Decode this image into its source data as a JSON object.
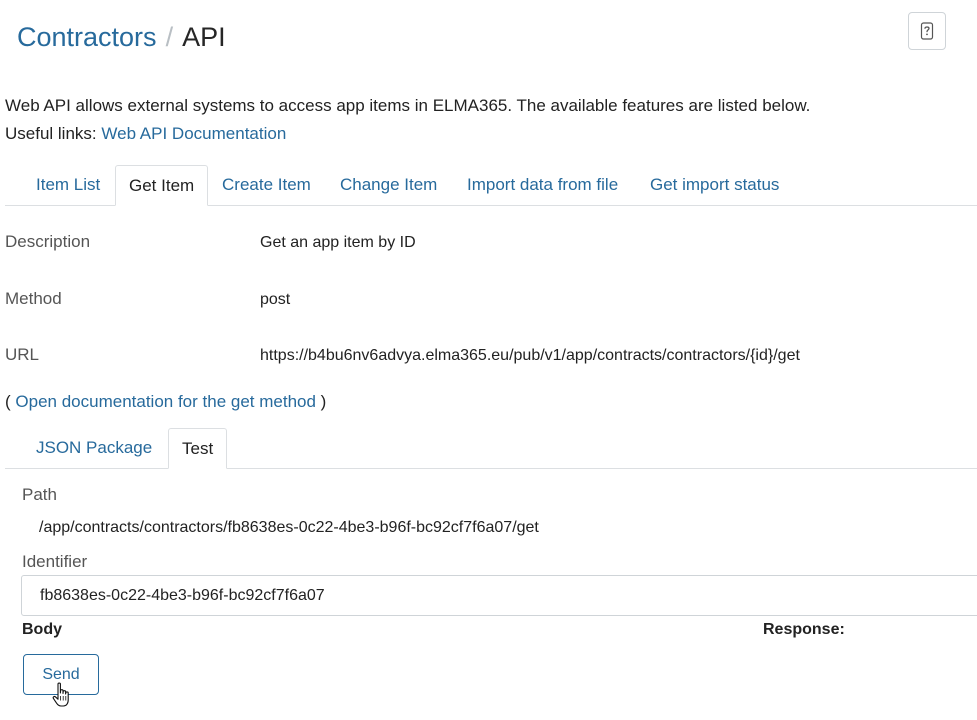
{
  "header": {
    "breadcrumb_root": "Contractors",
    "separator": "/",
    "current": "API",
    "help_icon": "question-icon"
  },
  "intro": {
    "text": "Web API allows external systems to access app items in ELMA365. The available features are listed below.",
    "links_label": "Useful links:",
    "doc_link": "Web API Documentation"
  },
  "tabs": [
    {
      "label": "Item List",
      "active": false
    },
    {
      "label": "Get Item",
      "active": true
    },
    {
      "label": "Create Item",
      "active": false
    },
    {
      "label": "Change Item",
      "active": false
    },
    {
      "label": "Import data from file",
      "active": false
    },
    {
      "label": "Get import status",
      "active": false
    }
  ],
  "details": {
    "description_label": "Description",
    "description_value": "Get an app item by ID",
    "method_label": "Method",
    "method_value": "post",
    "url_label": "URL",
    "url_value": "https://b4bu6nv6advya.elma365.eu/pub/v1/app/contracts/contractors/{id}/get"
  },
  "doc_method": {
    "open_paren": "(",
    "link": "Open documentation for the get method",
    "close_paren": ")"
  },
  "subtabs": [
    {
      "label": "JSON Package",
      "active": false
    },
    {
      "label": "Test",
      "active": true
    }
  ],
  "test": {
    "path_label": "Path",
    "path_value": "/app/contracts/contractors/fb8638es-0c22-4be3-b96f-bc92cf7f6a07/get",
    "identifier_label": "Identifier",
    "identifier_value": "fb8638es-0c22-4be3-b96f-bc92cf7f6a07",
    "body_label": "Body",
    "response_label": "Response:",
    "send_label": "Send"
  },
  "colors": {
    "link": "#276a9c",
    "text": "#222222",
    "muted": "#555555",
    "border": "#dcdfe2"
  }
}
